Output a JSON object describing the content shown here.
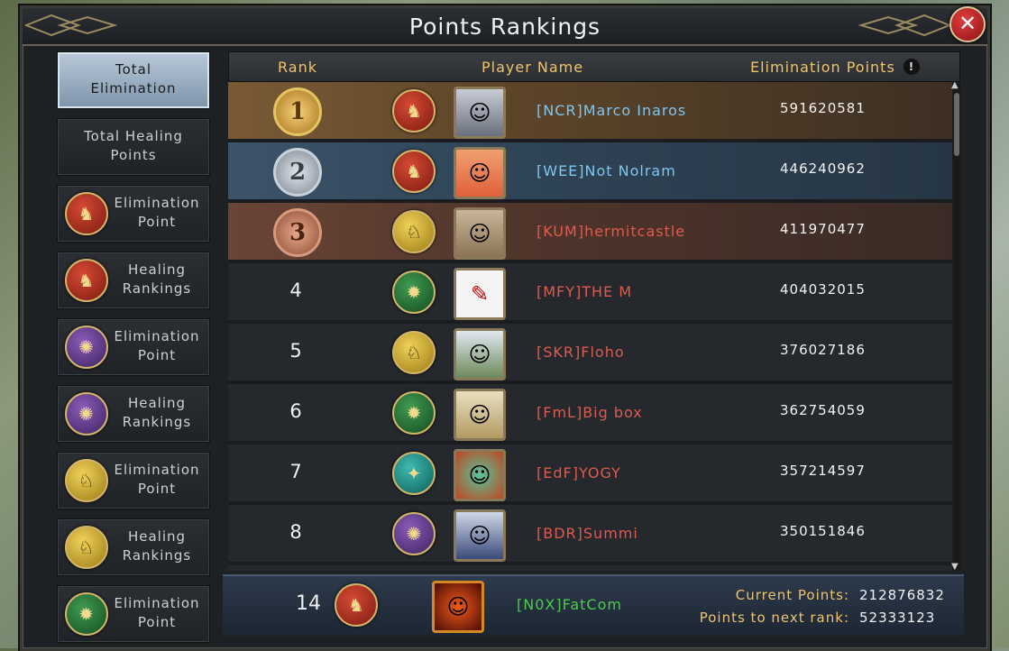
{
  "title": "Points Rankings",
  "close_icon": "✕",
  "sidebar": {
    "items": [
      {
        "label_line1": "Total",
        "label_line2": "Elimination",
        "badge": "",
        "active": true
      },
      {
        "label_line1": "Total Healing",
        "label_line2": "Points",
        "badge": "",
        "active": false
      },
      {
        "label_line1": "Elimination",
        "label_line2": "Point",
        "badge": "lion-icon",
        "color": "red"
      },
      {
        "label_line1": "Healing",
        "label_line2": "Rankings",
        "badge": "lion-icon",
        "color": "red"
      },
      {
        "label_line1": "Elimination",
        "label_line2": "Point",
        "badge": "dragon-icon",
        "color": "purple"
      },
      {
        "label_line1": "Healing",
        "label_line2": "Rankings",
        "badge": "dragon-icon",
        "color": "purple"
      },
      {
        "label_line1": "Elimination",
        "label_line2": "Point",
        "badge": "wolf-icon",
        "color": "gold"
      },
      {
        "label_line1": "Healing",
        "label_line2": "Rankings",
        "badge": "wolf-icon",
        "color": "gold"
      },
      {
        "label_line1": "Elimination",
        "label_line2": "Point",
        "badge": "sun-icon",
        "color": "green"
      }
    ]
  },
  "table": {
    "col_rank": "Rank",
    "col_player": "Player Name",
    "col_points": "Elimination Points",
    "info_icon": "!",
    "rows": [
      {
        "rank": "1",
        "name": "[NCR]Marco Inaros",
        "points": "591620581",
        "badge_color": "red",
        "name_color": "blue"
      },
      {
        "rank": "2",
        "name": "[WEE]Not Nolram",
        "points": "446240962",
        "badge_color": "red",
        "name_color": "blue"
      },
      {
        "rank": "3",
        "name": "[KUM]hermitcastle",
        "points": "411970477",
        "badge_color": "gold",
        "name_color": "red"
      },
      {
        "rank": "4",
        "name": "[MFY]THE M",
        "points": "404032015",
        "badge_color": "green",
        "name_color": "red"
      },
      {
        "rank": "5",
        "name": "[SKR]Floho",
        "points": "376027186",
        "badge_color": "gold",
        "name_color": "red"
      },
      {
        "rank": "6",
        "name": "[FmL]Big box",
        "points": "362754059",
        "badge_color": "green",
        "name_color": "red"
      },
      {
        "rank": "7",
        "name": "[EdF]YOGY",
        "points": "357214597",
        "badge_color": "teal",
        "name_color": "red"
      },
      {
        "rank": "8",
        "name": "[BDR]Summi",
        "points": "350151846",
        "badge_color": "purple",
        "name_color": "red"
      }
    ]
  },
  "footer": {
    "rank": "14",
    "name": "[N0X]FatCom",
    "current_label": "Current Points:",
    "current_value": "212876832",
    "next_label": "Points to next rank:",
    "next_value": "52333123"
  }
}
